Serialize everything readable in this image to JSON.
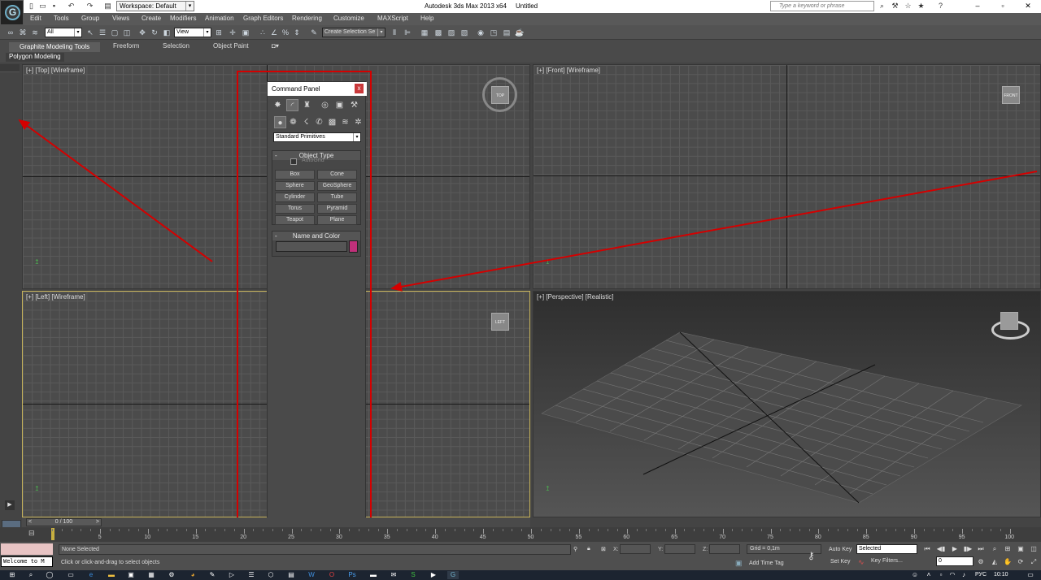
{
  "title": {
    "app": "Autodesk 3ds Max  2013 x64",
    "doc": "Untitled",
    "workspace": "Workspace: Default",
    "search_placeholder": "Type a keyword or phrase"
  },
  "menus": [
    "Edit",
    "Tools",
    "Group",
    "Views",
    "Create",
    "Modifiers",
    "Animation",
    "Graph Editors",
    "Rendering",
    "Customize",
    "MAXScript",
    "Help"
  ],
  "toolbar": {
    "selection_filter": "All",
    "ref_coord": "View",
    "named_selection": "Create Selection Se"
  },
  "ribbon": {
    "tabs": [
      "Graphite Modeling Tools",
      "Freeform",
      "Selection",
      "Object Paint"
    ],
    "sub_label": "Polygon Modeling"
  },
  "viewports": {
    "top": "[+] [Top] [Wireframe]",
    "front": "[+] [Front] [Wireframe]",
    "left": "[+] [Left] [Wireframe]",
    "perspective": "[+] [Perspective] [Realistic]"
  },
  "command_panel": {
    "title": "Command Panel",
    "close": "x",
    "category": "Standard Primitives",
    "object_type_title": "Object Type",
    "autogrid": "AutoGrid",
    "buttons": [
      "Box",
      "Cone",
      "Sphere",
      "GeoSphere",
      "Cylinder",
      "Tube",
      "Torus",
      "Pyramid",
      "Teapot",
      "Plane"
    ],
    "name_color_title": "Name and Color",
    "color": "#c0307a"
  },
  "timeline": {
    "slider": "0 / 100",
    "ticks": [
      "5",
      "10",
      "15",
      "20",
      "25",
      "30",
      "35",
      "40",
      "45",
      "50",
      "55",
      "60",
      "65",
      "70",
      "75",
      "80",
      "85",
      "90",
      "95",
      "100"
    ]
  },
  "status": {
    "listener": "Welcome to M",
    "selected": "None Selected",
    "prompt": "Click or click-and-drag to select objects",
    "x": "X:",
    "y": "Y:",
    "z": "Z:",
    "grid": "Grid = 0,1m",
    "add_time_tag": "Add Time Tag",
    "auto_key": "Auto Key",
    "set_key": "Set Key",
    "key_mode": "Selected",
    "key_filters": "Key Filters...",
    "frame": "0"
  },
  "taskbar": {
    "lang": "РУС",
    "time": "10:10"
  }
}
